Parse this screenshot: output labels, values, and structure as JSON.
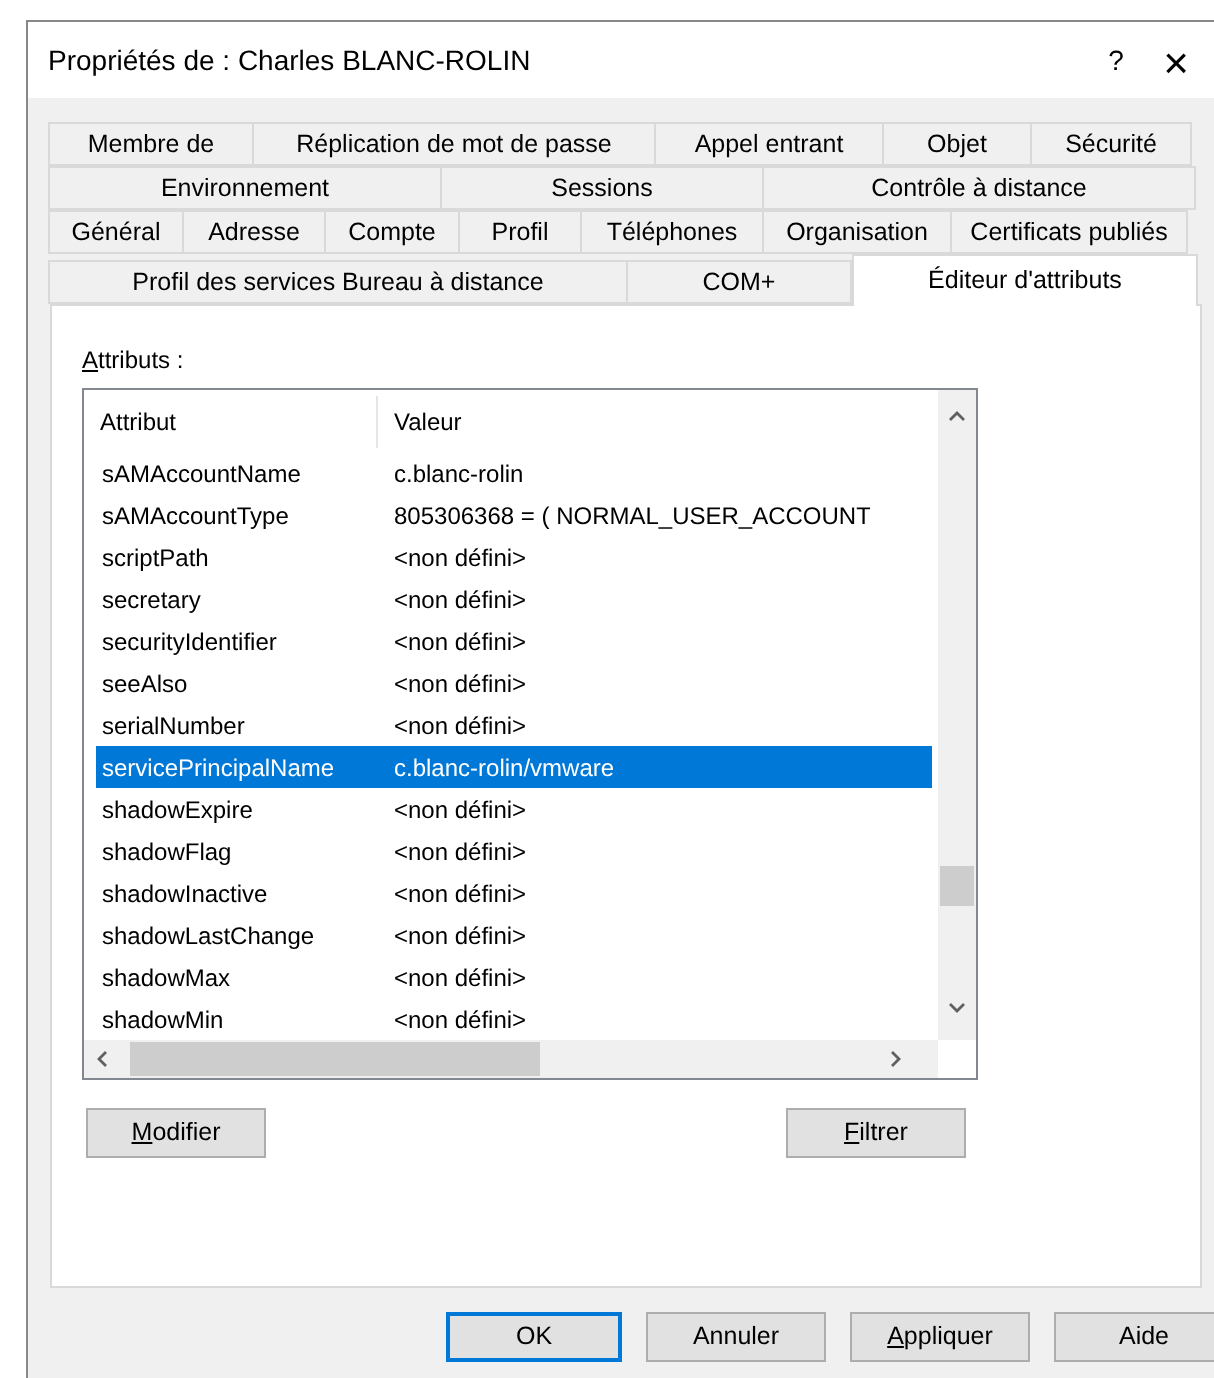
{
  "window": {
    "title": "Propriétés de : Charles BLANC-ROLIN",
    "help": "?",
    "close": "×"
  },
  "tab_rows": [
    [
      {
        "label": "Membre de",
        "selected": false
      },
      {
        "label": "Réplication de mot de passe",
        "selected": false
      },
      {
        "label": "Appel entrant",
        "selected": false
      },
      {
        "label": "Objet",
        "selected": false
      },
      {
        "label": "Sécurité",
        "selected": false
      }
    ],
    [
      {
        "label": "Environnement",
        "selected": false
      },
      {
        "label": "Sessions",
        "selected": false
      },
      {
        "label": "Contrôle à distance",
        "selected": false
      }
    ],
    [
      {
        "label": "Général",
        "selected": false
      },
      {
        "label": "Adresse",
        "selected": false
      },
      {
        "label": "Compte",
        "selected": false
      },
      {
        "label": "Profil",
        "selected": false
      },
      {
        "label": "Téléphones",
        "selected": false
      },
      {
        "label": "Organisation",
        "selected": false
      },
      {
        "label": "Certificats publiés",
        "selected": false
      }
    ],
    [
      {
        "label": "Profil des services Bureau à distance",
        "selected": false
      },
      {
        "label": "COM+",
        "selected": false
      },
      {
        "label": "Éditeur d'attributs",
        "selected": true
      }
    ]
  ],
  "attributes": {
    "label": "Attributs :",
    "access_key": true,
    "columns": [
      "Attribut",
      "Valeur"
    ],
    "rows": [
      {
        "attribute": "sAMAccountName",
        "value": "c.blanc-rolin",
        "selected": false
      },
      {
        "attribute": "sAMAccountType",
        "value": "805306368 = ( NORMAL_USER_ACCOUNT",
        "selected": false
      },
      {
        "attribute": "scriptPath",
        "value": "<non défini>",
        "selected": false
      },
      {
        "attribute": "secretary",
        "value": "<non défini>",
        "selected": false
      },
      {
        "attribute": "securityIdentifier",
        "value": "<non défini>",
        "selected": false
      },
      {
        "attribute": "seeAlso",
        "value": "<non défini>",
        "selected": false
      },
      {
        "attribute": "serialNumber",
        "value": "<non défini>",
        "selected": false
      },
      {
        "attribute": "servicePrincipalName",
        "value": "c.blanc-rolin/vmware",
        "selected": true
      },
      {
        "attribute": "shadowExpire",
        "value": "<non défini>",
        "selected": false
      },
      {
        "attribute": "shadowFlag",
        "value": "<non défini>",
        "selected": false
      },
      {
        "attribute": "shadowInactive",
        "value": "<non défini>",
        "selected": false
      },
      {
        "attribute": "shadowLastChange",
        "value": "<non défini>",
        "selected": false
      },
      {
        "attribute": "shadowMax",
        "value": "<non défini>",
        "selected": false
      },
      {
        "attribute": "shadowMin",
        "value": "<non défini>",
        "selected": false
      }
    ]
  },
  "page_buttons": [
    {
      "label": "Modifier",
      "access_key": true
    },
    {
      "label": "Filtrer",
      "access_key": true
    }
  ],
  "dialog_buttons": [
    {
      "label": "OK",
      "default": true
    },
    {
      "label": "Annuler",
      "default": false
    },
    {
      "label": "Appliquer",
      "default": false,
      "access_key": true
    },
    {
      "label": "Aide",
      "default": false
    }
  ]
}
